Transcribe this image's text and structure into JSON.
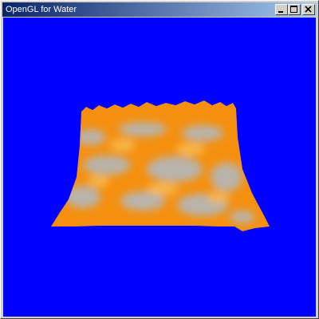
{
  "window": {
    "title": "OpenGL for Water",
    "controls": {
      "minimize_icon": "minimize-icon",
      "maximize_icon": "maximize-icon",
      "close_icon": "close-icon"
    }
  },
  "viewport": {
    "background_color": "#0000ff",
    "surface_colors": {
      "orange": "#f5900f",
      "light_orange": "#f7b64a",
      "grey": "#b8b4ac"
    }
  }
}
